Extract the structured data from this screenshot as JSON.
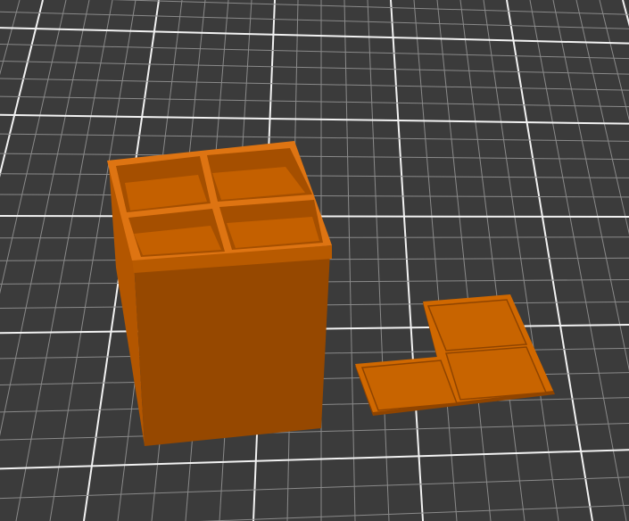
{
  "viewport": {
    "background_color": "#3b3b3b",
    "grid_minor_color": "#8a8a8a",
    "grid_major_color": "#f2f2f2",
    "model_color": "#c86400",
    "model_dark_color": "#8f4400",
    "model_light_color": "#e07410"
  },
  "objects": [
    {
      "name": "box",
      "compartments": 4
    },
    {
      "name": "lid",
      "tiles": 3
    }
  ]
}
